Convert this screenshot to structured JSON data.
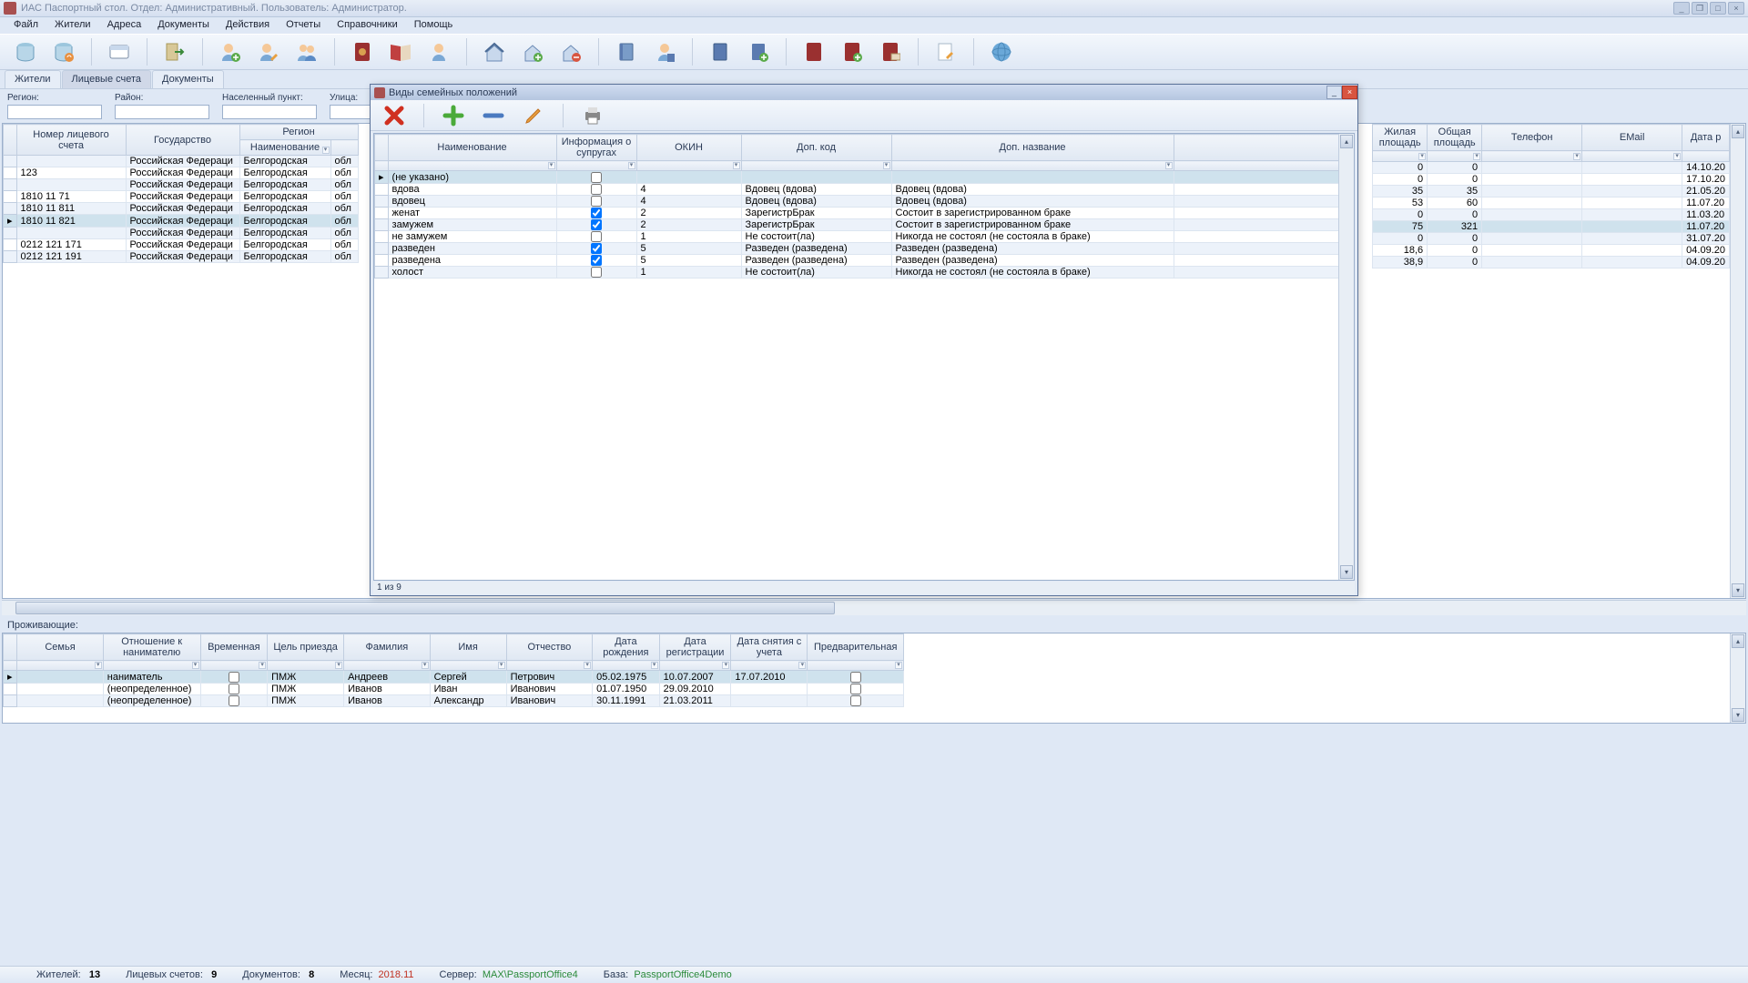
{
  "title": "ИАС Паспортный стол. Отдел: Административный. Пользователь: Администратор.",
  "menu": [
    "Файл",
    "Жители",
    "Адреса",
    "Документы",
    "Действия",
    "Отчеты",
    "Справочники",
    "Помощь"
  ],
  "tabs": [
    "Жители",
    "Лицевые счета",
    "Документы"
  ],
  "active_tab": 1,
  "filters": [
    {
      "label": "Регион:",
      "value": ""
    },
    {
      "label": "Район:",
      "value": ""
    },
    {
      "label": "Населенный пункт:",
      "value": ""
    },
    {
      "label": "Улица:",
      "value": ""
    }
  ],
  "main_headers_top": [
    "",
    "Номер лицевого счета",
    "Государство",
    "Регион"
  ],
  "main_sub_region": "Наименование",
  "main_rows": [
    {
      "n": "",
      "g": "Российская Федераци",
      "r": "Белгородская",
      "o": "обл"
    },
    {
      "n": "123",
      "g": "Российская Федераци",
      "r": "Белгородская",
      "o": "обл"
    },
    {
      "n": "",
      "g": "Российская Федераци",
      "r": "Белгородская",
      "o": "обл"
    },
    {
      "n": "1810 11 71",
      "g": "Российская Федераци",
      "r": "Белгородская",
      "o": "обл"
    },
    {
      "n": "1810 11 811",
      "g": "Российская Федераци",
      "r": "Белгородская",
      "o": "обл"
    },
    {
      "n": "1810 11 821",
      "g": "Российская Федераци",
      "r": "Белгородская",
      "o": "обл",
      "sel": true
    },
    {
      "n": "",
      "g": "Российская Федераци",
      "r": "Белгородская",
      "o": "обл"
    },
    {
      "n": "0212 121 171",
      "g": "Российская Федераци",
      "r": "Белгородская",
      "o": "обл"
    },
    {
      "n": "0212 121 191",
      "g": "Российская Федераци",
      "r": "Белгородская",
      "o": "обл"
    }
  ],
  "right_headers": [
    "Жилая площадь",
    "Общая площадь",
    "Телефон",
    "EMail",
    "Дата р"
  ],
  "right_rows": [
    {
      "a": "0",
      "b": "0",
      "t": "",
      "e": "",
      "d": "14.10.20"
    },
    {
      "a": "0",
      "b": "0",
      "t": "",
      "e": "",
      "d": "17.10.20"
    },
    {
      "a": "35",
      "b": "35",
      "t": "",
      "e": "",
      "d": "21.05.20"
    },
    {
      "a": "53",
      "b": "60",
      "t": "",
      "e": "",
      "d": "11.07.20"
    },
    {
      "a": "0",
      "b": "0",
      "t": "",
      "e": "",
      "d": "11.03.20"
    },
    {
      "a": "75",
      "b": "321",
      "t": "",
      "e": "",
      "d": "11.07.20",
      "sel": true
    },
    {
      "a": "0",
      "b": "0",
      "t": "",
      "e": "",
      "d": "31.07.20"
    },
    {
      "a": "18,6",
      "b": "0",
      "t": "",
      "e": "",
      "d": "04.09.20"
    },
    {
      "a": "38,9",
      "b": "0",
      "t": "",
      "e": "",
      "d": "04.09.20"
    }
  ],
  "residents_label": "Проживающие:",
  "bottom_headers": [
    "",
    "Семья",
    "Отношение к нанимателю",
    "Временная",
    "Цель приезда",
    "Фамилия",
    "Имя",
    "Отчество",
    "Дата рождения",
    "Дата регистрации",
    "Дата снятия с учета",
    "Предварительная"
  ],
  "bottom_rows": [
    {
      "s": "",
      "o": "наниматель",
      "t": false,
      "c": "ПМЖ",
      "f": "Андреев",
      "i": "Сергей",
      "p": "Петрович",
      "dr": "05.02.1975",
      "dreg": "10.07.2007",
      "ds": "17.07.2010",
      "pre": false,
      "sel": true
    },
    {
      "s": "",
      "o": "(неопределенное)",
      "t": false,
      "c": "ПМЖ",
      "f": "Иванов",
      "i": "Иван",
      "p": "Иванович",
      "dr": "01.07.1950",
      "dreg": "29.09.2010",
      "ds": "",
      "pre": false
    },
    {
      "s": "",
      "o": "(неопределенное)",
      "t": false,
      "c": "ПМЖ",
      "f": "Иванов",
      "i": "Александр",
      "p": "Иванович",
      "dr": "30.11.1991",
      "dreg": "21.03.2011",
      "ds": "",
      "pre": false
    }
  ],
  "modal": {
    "title": "Виды семейных положений",
    "headers": [
      "",
      "Наименование",
      "Информация о супругах",
      "ОКИН",
      "Доп. код",
      "Доп. название"
    ],
    "rows": [
      {
        "n": "(не указано)",
        "i": false,
        "ok": "",
        "dk": "",
        "dn": "",
        "sel": true
      },
      {
        "n": "вдова",
        "i": false,
        "ok": "4",
        "dk": "Вдовец (вдова)",
        "dn": "Вдовец (вдова)"
      },
      {
        "n": "вдовец",
        "i": false,
        "ok": "4",
        "dk": "Вдовец (вдова)",
        "dn": "Вдовец (вдова)"
      },
      {
        "n": "женат",
        "i": true,
        "ok": "2",
        "dk": "ЗарегистрБрак",
        "dn": "Состоит в зарегистрированном браке"
      },
      {
        "n": "замужем",
        "i": true,
        "ok": "2",
        "dk": "ЗарегистрБрак",
        "dn": "Состоит в зарегистрированном браке"
      },
      {
        "n": "не замужем",
        "i": false,
        "ok": "1",
        "dk": "Не состоит(ла)",
        "dn": "Никогда не состоял (не состояла в браке)"
      },
      {
        "n": "разведен",
        "i": true,
        "ok": "5",
        "dk": "Разведен (разведена)",
        "dn": "Разведен (разведена)"
      },
      {
        "n": "разведена",
        "i": true,
        "ok": "5",
        "dk": "Разведен (разведена)",
        "dn": "Разведен (разведена)"
      },
      {
        "n": "холост",
        "i": false,
        "ok": "1",
        "dk": "Не состоит(ла)",
        "dn": "Никогда не состоял (не состояла в браке)"
      }
    ],
    "status": "1 из 9"
  },
  "status": {
    "residents_lbl": "Жителей:",
    "residents": "13",
    "accounts_lbl": "Лицевых счетов:",
    "accounts": "9",
    "docs_lbl": "Документов:",
    "docs": "8",
    "month_lbl": "Месяц:",
    "month": "2018.11",
    "server_lbl": "Сервер:",
    "server": "MAX\\PassportOffice4",
    "base_lbl": "База:",
    "base": "PassportOffice4Demo"
  }
}
